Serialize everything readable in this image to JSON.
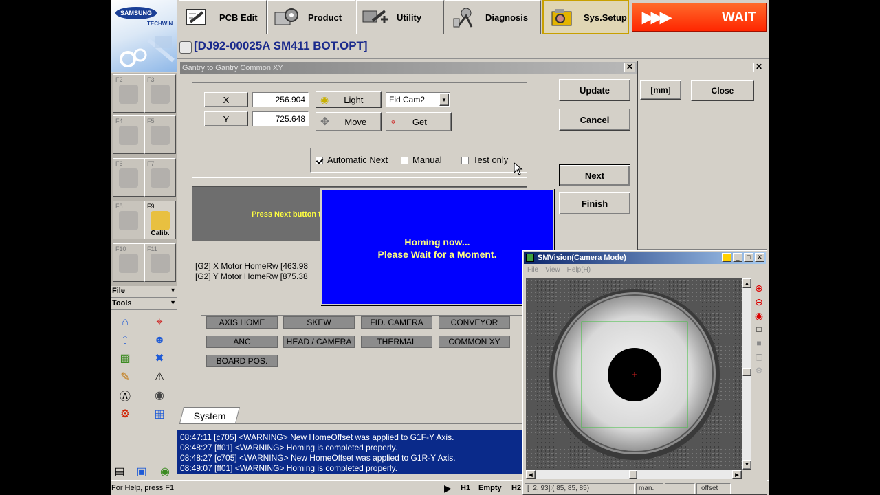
{
  "toolbar": {
    "logo_brand": "SAMSUNG",
    "logo_sub": "TECHWIN",
    "buttons": [
      {
        "label": "PCB Edit",
        "icon": "pcb-edit-icon"
      },
      {
        "label": "Product",
        "icon": "product-icon"
      },
      {
        "label": "Utility",
        "icon": "utility-icon"
      },
      {
        "label": "Diagnosis",
        "icon": "diagnosis-icon"
      },
      {
        "label": "Sys.Setup",
        "icon": "sys-setup-icon"
      }
    ],
    "wait_label": "WAIT",
    "wait_color": "#ff3a00"
  },
  "program_title": "[DJ92-00025A SM411 BOT.OPT]",
  "fkeys": [
    {
      "label": "F2",
      "caption": ""
    },
    {
      "label": "F3",
      "caption": ""
    },
    {
      "label": "F4",
      "caption": ""
    },
    {
      "label": "F5",
      "caption": ""
    },
    {
      "label": "F6",
      "caption": ""
    },
    {
      "label": "F7",
      "caption": ""
    },
    {
      "label": "F8",
      "caption": ""
    },
    {
      "label": "F9",
      "caption": "Calib."
    },
    {
      "label": "F10",
      "caption": ""
    },
    {
      "label": "F11",
      "caption": ""
    }
  ],
  "side_menus": {
    "file": "File",
    "tools": "Tools"
  },
  "dialog": {
    "title": "Gantry to Gantry Common XY",
    "x_label": "X",
    "x_value": "256.904",
    "y_label": "Y",
    "y_value": "725.648",
    "light_label": "Light",
    "move_label": "Move",
    "get_label": "Get",
    "camera_select": "Fid Cam2",
    "auto_next_label": "Automatic Next",
    "manual_label": "Manual",
    "test_only_label": "Test only",
    "update_label": "Update",
    "cancel_label": "Cancel",
    "next_label": "Next",
    "finish_label": "Finish",
    "instruction": "Press Next button t",
    "log_lines": [
      "[G2] X Motor HomeRw [463.98",
      "[G2] Y Motor HomeRw [875.38"
    ]
  },
  "back_dialog": {
    "unit_label": "[mm]",
    "close_label": "Close"
  },
  "homing": {
    "line1": "Homing now...",
    "line2": "Please Wait for a Moment.",
    "bg_color": "#0000ff"
  },
  "categories": [
    "AXIS HOME",
    "SKEW",
    "FID. CAMERA",
    "CONVEYOR",
    "ANC",
    "HEAD / CAMERA",
    "THERMAL",
    "COMMON XY",
    "BOARD POS."
  ],
  "system_tab": "System",
  "messages": [
    "08:47:11 [c705] <WARNING> New HomeOffset was applied to G1F-Y Axis.",
    "08:48:27 [ff01] <WARNING> Homing is completed properly.",
    "08:48:27 [c705] <WARNING> New HomeOffset was applied to G1R-Y Axis.",
    "08:49:07 [ff01] <WARNING> Homing is completed properly."
  ],
  "statusbar": {
    "help": "For Help, press F1",
    "h1": "H1",
    "h1_state": "Empty",
    "h2": "H2"
  },
  "vision": {
    "title": "SMVision(Camera Mode)",
    "menu": [
      "File",
      "View",
      "Help(H)"
    ],
    "status_pixel": "[  2, 93]:( 85, 85, 85)",
    "status_mode": "man.",
    "status_offset": "offset"
  }
}
